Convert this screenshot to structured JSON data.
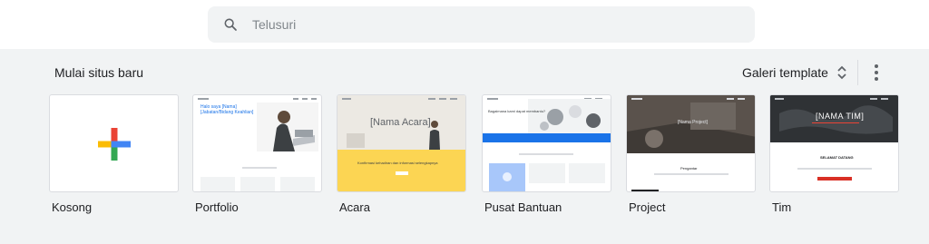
{
  "search": {
    "placeholder": "Telusuri"
  },
  "section": {
    "title": "Mulai situs baru"
  },
  "gallery": {
    "label": "Galeri template"
  },
  "templates": [
    {
      "label": "Kosong"
    },
    {
      "label": "Portfolio",
      "hero_text": "Halo saya [Nama] [Jabatan/Bidang Keahlian]"
    },
    {
      "label": "Acara",
      "hero_text": "[Nama Acara]",
      "banner_text": "Konfirmasi kehadiran dan informasi selengkapnya"
    },
    {
      "label": "Pusat Bantuan",
      "hero_text": "Bagaimana kami dapat membantu?"
    },
    {
      "label": "Project",
      "hero_text": "[Nama Project]",
      "sub_text": "Pengantar"
    },
    {
      "label": "Tim",
      "hero_text": "[NAMA TIM]",
      "sub_text": "SELAMAT DATANG"
    }
  ],
  "colors": {
    "google_blue": "#4285f4",
    "google_red": "#ea4335",
    "google_yellow": "#fbbc04",
    "google_green": "#34a853",
    "event_yellow": "#fcd553",
    "help_blue": "#1a73e8"
  }
}
